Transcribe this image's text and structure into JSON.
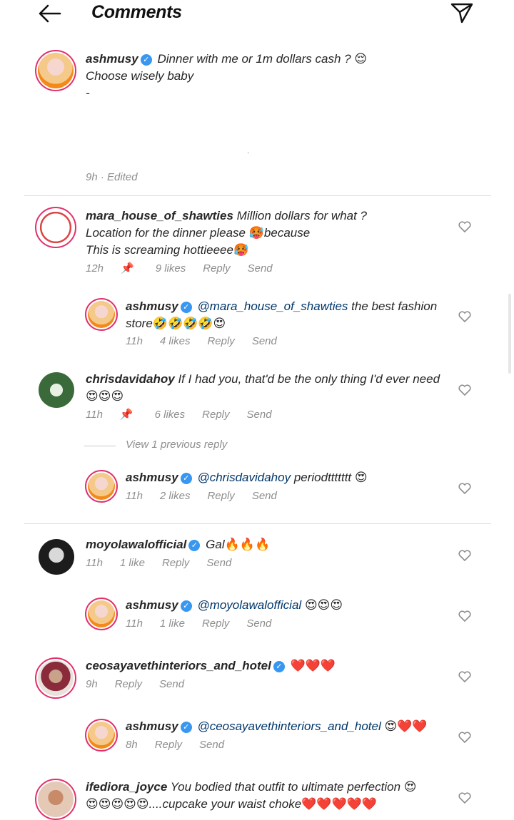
{
  "header": {
    "title": "Comments"
  },
  "caption": {
    "username": "ashmusy",
    "line1": "Dinner with me or 1m dollars cash ?",
    "line1_emoji": "😌",
    "line2": "Choose wisely baby",
    "line3": "-",
    "dot": ".",
    "meta": "9h · Edited"
  },
  "comments": [
    {
      "username": "mara_house_of_shawties",
      "text1": "Million dollars for what ?",
      "text2a": "Location for the dinner please",
      "emoji2": "🥵",
      "text2b": "because",
      "text3": "This is screaming hottieeee",
      "emoji3": "🥵",
      "time": "12h",
      "likes": "9 likes",
      "reply": "Reply",
      "send": "Send"
    },
    {
      "username": "ashmusy",
      "mention": "@mara_house_of_shawties",
      "text1": "the best fashion",
      "text2": "store",
      "emoji2": "🤣🤣🤣🤣😍",
      "time": "11h",
      "likes": "4 likes",
      "reply": "Reply",
      "send": "Send"
    },
    {
      "username": "chrisdavidahoy",
      "text1": "If I had you, that'd be the only thing I'd ever need",
      "emoji2": "😍😍😍",
      "time": "11h",
      "likes": "6 likes",
      "reply": "Reply",
      "send": "Send",
      "view_replies": "View 1 previous reply"
    },
    {
      "username": "ashmusy",
      "mention": "@chrisdavidahoy",
      "text1": "periodttttttt",
      "emoji1": "😍",
      "time": "11h",
      "likes": "2 likes",
      "reply": "Reply",
      "send": "Send"
    },
    {
      "username": "moyolawalofficial",
      "text1": "Gal",
      "emoji1": "🔥🔥🔥",
      "time": "11h",
      "likes": "1 like",
      "reply": "Reply",
      "send": "Send"
    },
    {
      "username": "ashmusy",
      "mention": "@moyolawalofficial",
      "emoji1": "😍😍😍",
      "time": "11h",
      "likes": "1 like",
      "reply": "Reply",
      "send": "Send"
    },
    {
      "username": "ceosayavethinteriors_and_hotel",
      "emoji1": "❤️❤️❤️",
      "time": "9h",
      "reply": "Reply",
      "send": "Send"
    },
    {
      "username": "ashmusy",
      "mention": "@ceosayavethinteriors_and_hotel",
      "emoji1": "😍❤️❤️",
      "time": "8h",
      "reply": "Reply",
      "send": "Send"
    },
    {
      "username": "ifediora_joyce",
      "text1": "You bodied that outfit to ultimate perfection",
      "emoji1": "😍",
      "emoji2": "😍😍😍😍😍",
      "text2": "....cupcake your waist choke",
      "emoji2b": "❤️❤️❤️❤️❤️"
    }
  ]
}
